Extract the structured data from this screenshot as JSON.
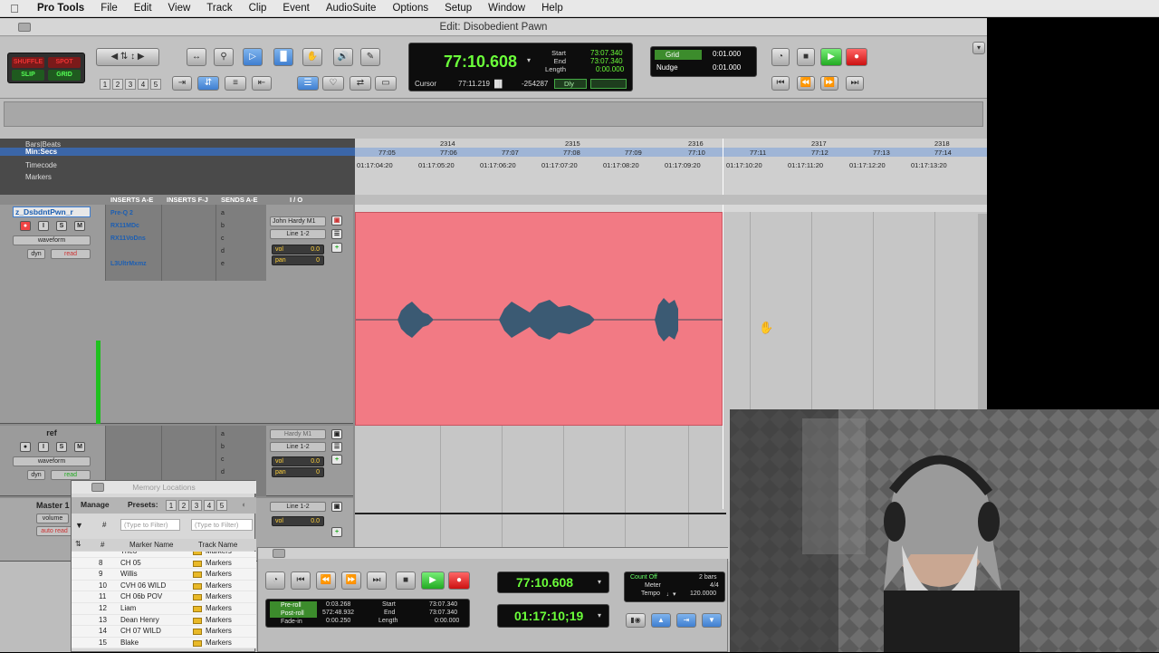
{
  "menubar": {
    "app": "Pro Tools",
    "items": [
      "File",
      "Edit",
      "View",
      "Track",
      "Clip",
      "Event",
      "AudioSuite",
      "Options",
      "Setup",
      "Window",
      "Help"
    ]
  },
  "window": {
    "title": "Edit: Disobedient Pawn"
  },
  "modes": {
    "shuffle": "SHUFFLE",
    "spot": "SPOT",
    "slip": "SLIP",
    "grid": "GRID"
  },
  "zoom_presets": [
    "1",
    "2",
    "3",
    "4",
    "5"
  ],
  "counter": {
    "main": "77:10.608",
    "start_label": "Start",
    "end_label": "End",
    "length_label": "Length",
    "start": "73:07.340",
    "end": "73:07.340",
    "length": "0:00.000",
    "cursor_label": "Cursor",
    "cursor": "77:11.219",
    "cursor_sample": "-254287",
    "dly": "Dly"
  },
  "grid": {
    "grid_label": "Grid",
    "grid_value": "0:01.000",
    "nudge_label": "Nudge",
    "nudge_value": "0:01.000"
  },
  "rulers": {
    "bars": "Bars|Beats",
    "minsecs": "Min:Secs",
    "timecode": "Timecode",
    "markers": "Markers",
    "bar_ticks": [
      "2314",
      "2315",
      "2316",
      "2317",
      "2318"
    ],
    "min_ticks": [
      "77:05",
      "77:06",
      "77:07",
      "77:08",
      "77:09",
      "77:10",
      "77:11",
      "77:12",
      "77:13",
      "77:14"
    ],
    "tc_ticks": [
      "01:17:04:20",
      "01:17:05:20",
      "01:17:06:20",
      "01:17:07:20",
      "01:17:08:20",
      "01:17:09:20",
      "01:17:10:20",
      "01:17:11:20",
      "01:17:12:20",
      "01:17:13:20"
    ]
  },
  "mix_headers": {
    "inserts_ae": "INSERTS A-E",
    "inserts_fj": "INSERTS F-J",
    "sends_ae": "SENDS A-E",
    "io": "I / O"
  },
  "tracks": [
    {
      "name": "z_DsbdntPwn_r",
      "view": "waveform",
      "dyn": "dyn",
      "auto": "read",
      "inserts": [
        "Pre-Q 2",
        "RX11MDc",
        "RX11VoDns",
        "",
        "L3UltrMxmz"
      ],
      "sends": [
        "a",
        "b",
        "c",
        "d",
        "e"
      ],
      "input": "John Hardy M1",
      "output": "Line 1-2",
      "vol": "vol",
      "vol_val": "0.0",
      "pan": "pan",
      "pan_val": "0"
    },
    {
      "name": "ref",
      "view": "waveform",
      "dyn": "dyn",
      "auto": "read",
      "sends": [
        "a",
        "b",
        "c",
        "d",
        "e"
      ],
      "input": "Hardy M1",
      "output": "Line 1-2",
      "vol": "vol",
      "vol_val": "0.0",
      "pan": "pan",
      "pan_val": "0"
    },
    {
      "name": "Master 1",
      "view": "volume",
      "auto": "auto read",
      "output": "Line 1-2",
      "vol": "vol",
      "vol_val": "0.0"
    }
  ],
  "track_buttons": {
    "rec": "●",
    "input": "I",
    "solo": "S",
    "mute": "M"
  },
  "memory": {
    "title": "Memory Locations",
    "manage": "Manage",
    "presets": "Presets:",
    "preset_nums": [
      "1",
      "2",
      "3",
      "4",
      "5"
    ],
    "num_header": "#",
    "filter1": "(Type to Filter)",
    "filter2": "(Type to Filter)",
    "col_marker": "Marker Name",
    "col_track": "Track Name",
    "rows": [
      {
        "num": "",
        "name": "Theo",
        "track": "Markers"
      },
      {
        "num": "8",
        "name": "CH 05",
        "track": "Markers"
      },
      {
        "num": "9",
        "name": "Willis",
        "track": "Markers"
      },
      {
        "num": "10",
        "name": "CVH 06 WILD",
        "track": "Markers"
      },
      {
        "num": "11",
        "name": "CH 06b POV",
        "track": "Markers"
      },
      {
        "num": "12",
        "name": "Liam",
        "track": "Markers"
      },
      {
        "num": "13",
        "name": "Dean Henry",
        "track": "Markers"
      },
      {
        "num": "14",
        "name": "CH 07 WILD",
        "track": "Markers"
      },
      {
        "num": "15",
        "name": "Blake",
        "track": "Markers"
      }
    ]
  },
  "transport_win": {
    "main": "77:10.608",
    "sub": "01:17:10;19",
    "preroll_label": "Pre-roll",
    "postroll_label": "Post-roll",
    "fadein_label": "Fade-in",
    "preroll": "0:03.268",
    "postroll": "572:48.932",
    "fadein": "0:00.250",
    "start_label": "Start",
    "end_label": "End",
    "length_label": "Length",
    "start": "73:07.340",
    "end": "73:07.340",
    "length": "0:00.000",
    "count_off": "Count Off",
    "count_bars": "2 bars",
    "meter_label": "Meter",
    "meter": "4/4",
    "tempo_label": "Tempo",
    "tempo": "120.0000"
  },
  "colors": {
    "clip": "#f27a84",
    "accent": "#3f7ed0",
    "counter_green": "#6bff3a"
  }
}
